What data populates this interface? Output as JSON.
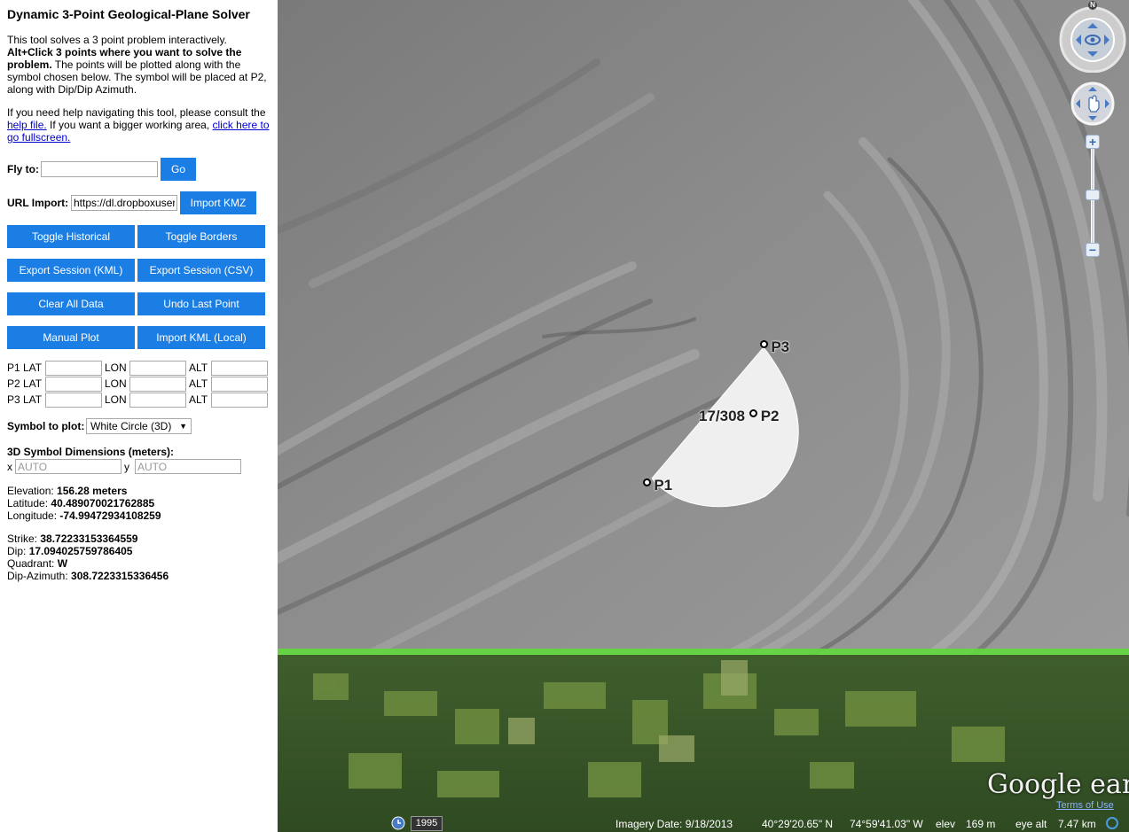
{
  "app": {
    "title": "Dynamic 3-Point Geological-Plane Solver",
    "intro_plain": "This tool solves a 3 point problem interactively.",
    "intro_bold": "Alt+Click 3 points where you want to solve the problem.",
    "intro_rest": "The points will be plotted along with the symbol chosen below. The symbol will be placed at P2, along with Dip/Dip Azimuth.",
    "help_pre": "If you need help navigating this tool, please consult the",
    "help_link": "help file.",
    "help_mid": "If you want a bigger working area,",
    "fullscreen_link": "click here to go fullscreen."
  },
  "flyto": {
    "label": "Fly to:",
    "value": "",
    "button": "Go"
  },
  "url_import": {
    "label": "URL Import:",
    "value": "https://dl.dropboxuser",
    "button": "Import KMZ"
  },
  "buttons": {
    "toggle_historical": "Toggle Historical",
    "toggle_borders": "Toggle Borders",
    "export_kml": "Export Session (KML)",
    "export_csv": "Export Session (CSV)",
    "clear_all": "Clear All Data",
    "undo_last": "Undo Last Point",
    "manual_plot": "Manual Plot",
    "import_kml_local": "Import KML (Local)"
  },
  "coords": {
    "rows": [
      {
        "label": "P1 LAT",
        "lon": "LON",
        "alt": "ALT"
      },
      {
        "label": "P2 LAT",
        "lon": "LON",
        "alt": "ALT"
      },
      {
        "label": "P3 LAT",
        "lon": "LON",
        "alt": "ALT"
      }
    ]
  },
  "symbol": {
    "label": "Symbol to plot:",
    "selected": "White Circle (3D)"
  },
  "dimensions": {
    "label": "3D Symbol Dimensions (meters):",
    "x_label": "x",
    "y_label": "y",
    "x_placeholder": "AUTO",
    "y_placeholder": "AUTO"
  },
  "info": {
    "elevation_label": "Elevation:",
    "elevation": "156.28 meters",
    "latitude_label": "Latitude:",
    "latitude": "40.489070021762885",
    "longitude_label": "Longitude:",
    "longitude": "-74.99472934108259",
    "strike_label": "Strike:",
    "strike": "38.72233153364559",
    "dip_label": "Dip:",
    "dip": "17.094025759786405",
    "quadrant_label": "Quadrant:",
    "quadrant": "W",
    "dipaz_label": "Dip-Azimuth:",
    "dipaz": "308.7223315336456"
  },
  "map": {
    "markers": {
      "p1": "P1",
      "p2": "P2",
      "p3": "P3",
      "dip_label": "17/308"
    },
    "compass_n": "N",
    "historical_year": "1995",
    "imagery_date": "Imagery Date: 9/18/2013",
    "lat_readout": "40°29'20.65\" N",
    "lon_readout": "74°59'41.03\" W",
    "elev_label": "elev",
    "elev_value": "169 m",
    "eye_label": "eye alt",
    "eye_value": "7.47 km",
    "logo": "Google earth",
    "terms": "Terms of Use"
  },
  "colors": {
    "button_blue": "#1b7ee5",
    "link_blue": "#0000cc",
    "border_green": "#5fd93a"
  }
}
